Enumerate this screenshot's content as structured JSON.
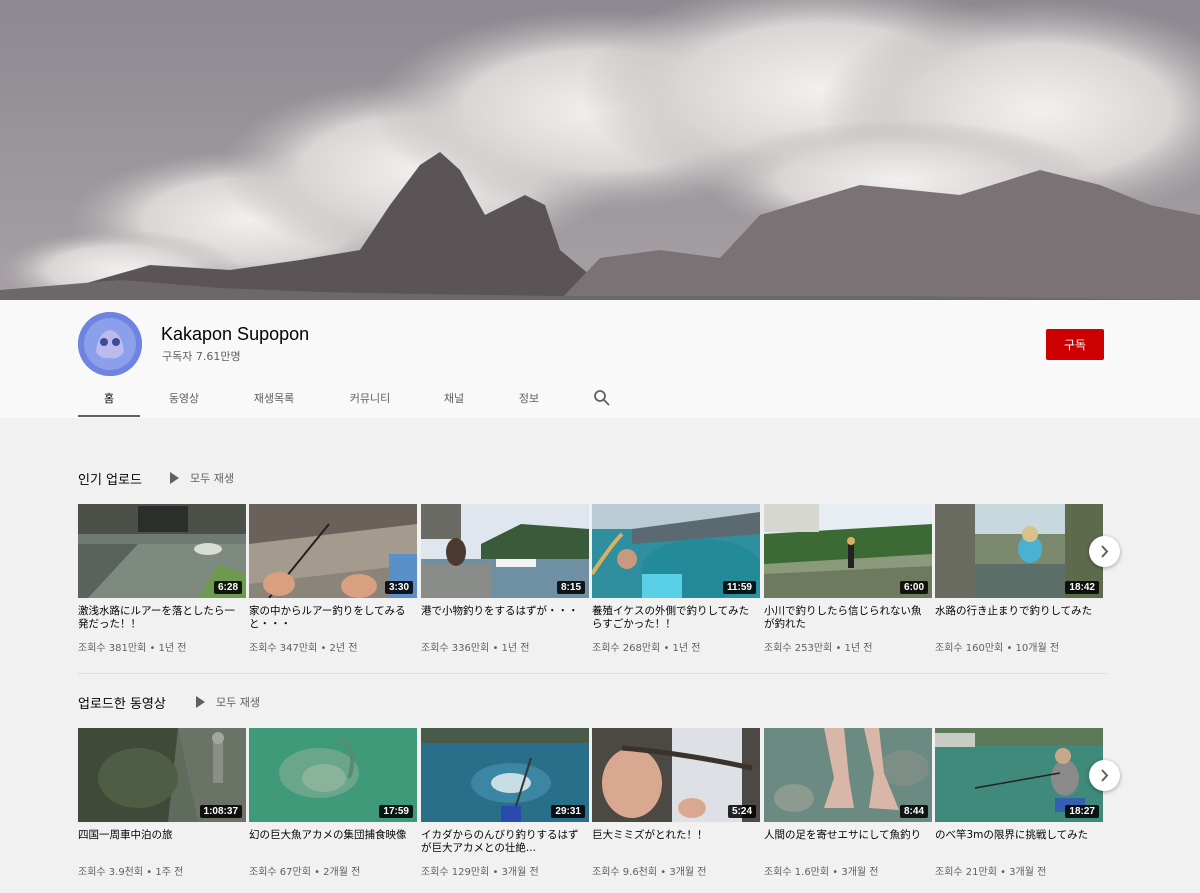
{
  "channel": {
    "name": "Kakapon Supopon",
    "subscribers": "구독자 7.61만명",
    "subscribe_label": "구독"
  },
  "tabs": [
    {
      "label": "홈",
      "active": true
    },
    {
      "label": "동영상",
      "active": false
    },
    {
      "label": "재생목록",
      "active": false
    },
    {
      "label": "커뮤니티",
      "active": false
    },
    {
      "label": "채널",
      "active": false
    },
    {
      "label": "정보",
      "active": false
    }
  ],
  "shelves": [
    {
      "title": "인기 업로드",
      "play_all": "모두 재생",
      "videos": [
        {
          "title": "激浅水路にルアーを落としたら一発だった！！",
          "meta": "조회수 381만회 • 1년 전",
          "duration": "6:28"
        },
        {
          "title": "家の中からルアー釣りをしてみると・・・",
          "meta": "조회수 347만회 • 2년 전",
          "duration": "3:30"
        },
        {
          "title": "港で小物釣りをするはずが・・・",
          "meta": "조회수 336만회 • 1년 전",
          "duration": "8:15"
        },
        {
          "title": "養殖イケスの外側で釣りしてみたらすごかった！！",
          "meta": "조회수 268만회 • 1년 전",
          "duration": "11:59"
        },
        {
          "title": "小川で釣りしたら信じられない魚が釣れた",
          "meta": "조회수 253만회 • 1년 전",
          "duration": "6:00"
        },
        {
          "title": "水路の行き止まりで釣りしてみた",
          "meta": "조회수 160만회 • 10개월 전",
          "duration": "18:42"
        }
      ]
    },
    {
      "title": "업로드한 동영상",
      "play_all": "모두 재생",
      "videos": [
        {
          "title": "四国一周車中泊の旅",
          "meta": "조회수 3.9천회 • 1주 전",
          "duration": "1:08:37"
        },
        {
          "title": "幻の巨大魚アカメの集団捕食映像",
          "meta": "조회수 67만회 • 2개월 전",
          "duration": "17:59"
        },
        {
          "title": "イカダからのんびり釣りするはずが巨大アカメとの壮絶...",
          "meta": "조회수 129만회 • 3개월 전",
          "duration": "29:31"
        },
        {
          "title": "巨大ミミズがとれた！！",
          "meta": "조회수 9.6천회 • 3개월 전",
          "duration": "5:24"
        },
        {
          "title": "人間の足を寄せエサにして魚釣り",
          "meta": "조회수 1.6만회 • 3개월 전",
          "duration": "8:44"
        },
        {
          "title": "のべ竿3mの限界に挑戦してみた",
          "meta": "조회수 21만회 • 3개월 전",
          "duration": "18:27"
        }
      ]
    }
  ],
  "colors": {
    "subscribe": "#cc0000",
    "background": "#f1f1f1",
    "header": "#f9f9f9"
  }
}
